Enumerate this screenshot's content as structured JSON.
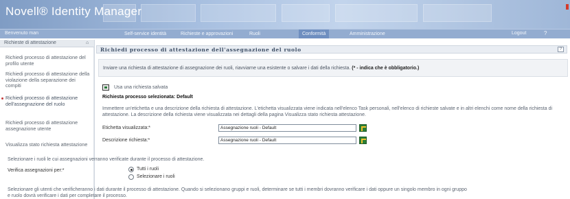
{
  "header": {
    "app_title": "Novell® Identity Manager",
    "colors": {
      "header_start": "#7f9cc4",
      "header_end": "#9fb7d8",
      "nav_bg": "#93acd0",
      "active_tab": "#6f8fc0",
      "accent_red": "#c43a3a"
    }
  },
  "nav": {
    "welcome": "Benvenuto man",
    "tabs": [
      {
        "label": "Self-service identità"
      },
      {
        "label": "Richieste e approvazioni"
      },
      {
        "label": "Ruoli"
      },
      {
        "label": "Conformità"
      },
      {
        "label": "Amministrazione"
      }
    ],
    "active_tab": "Conformità",
    "logout": "Logout",
    "help": "?"
  },
  "sidebar": {
    "header": "Richieste di attestazione",
    "collapse_icon": "pin-icon",
    "items": [
      {
        "label": "Richiedi processo di attestazione del profilo utente"
      },
      {
        "label": "Richiedi processo di attestazione della violazione della separazione dei compiti"
      },
      {
        "label": "Richiedi processo di attestazione dell'assegnazione del ruolo"
      },
      {
        "label": "Richiedi processo di attestazione assegnazione utente"
      },
      {
        "label": "Visualizza stato richiesta attestazione"
      }
    ],
    "active_index": 2
  },
  "main": {
    "title": "Richiedi processo di attestazione dell'assegnazione del ruolo",
    "help_icon": "help-icon",
    "intro_text": "Inviare una richiesta di attestazione di assegnazione dei ruoli, riavviarne una esistente o salvare i dati della richiesta.",
    "intro_required": "(* - indica che è obbligatorio.)",
    "saved_link": "Usa una richiesta salvata",
    "request_title": "Richiesta processo selezionata: Default",
    "para1": "Immettere un'etichetta e una descrizione della richiesta di attestazione. L'etichetta visualizzata viene indicata nell'elenco Task personali, nell'elenco di richieste salvate e in altri elenchi come nome della richiesta di attestazione. La descrizione della richiesta viene visualizzata nei dettagli della pagina Visualizza stato richiesta attestazione.",
    "fields": [
      {
        "label": "Etichetta visualizzata:*",
        "value": "Assegnazione ruoli - Default"
      },
      {
        "label": "Descrizione richiesta:*",
        "value": "Assegnazione ruoli - Default"
      }
    ],
    "select_roles_text": "Selezionare i ruoli le cui assegnazioni verranno verificate durante il processo di attestazione.",
    "verify_label": "Verifica assegnazioni per:*",
    "radio_options": [
      {
        "label": "Tutti i ruoli",
        "selected": true
      },
      {
        "label": "Selezionare i ruoli",
        "selected": false
      }
    ],
    "para2": "Selezionare gli utenti che verificheranno i dati durante il processo di attestazione. Quando si selezionano gruppi e ruoli, determinare se tutti i membri dovranno verificare i dati oppure un singolo membro in ogni gruppo e ruolo dovrà verificare i dati per completare il processo."
  }
}
